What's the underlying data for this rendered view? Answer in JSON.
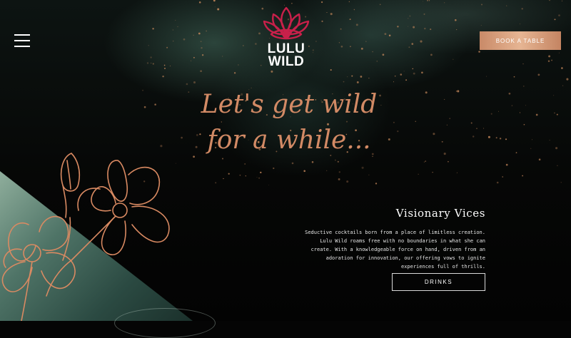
{
  "header": {
    "menu_icon": "hamburger-menu-icon",
    "logo": {
      "line1": "LULU",
      "line2": "WILD",
      "emblem_icon": "lotus-eye-icon",
      "emblem_color": "#c8204a"
    },
    "book_label": "BOOK A TABLE"
  },
  "hero": {
    "tagline_line1": "Let's get wild",
    "tagline_line2": "for a while..."
  },
  "section": {
    "title": "Visionary Vices",
    "lines": [
      "Seductive cocktails born from a place of limitless creation.",
      "Lulu Wild roams free with no boundaries in what she can",
      "create. With a knowledgeable force on hand, driven from an",
      "adoration for innovation, our offering vows to ignite",
      "experiences full of thrills."
    ],
    "button_label": "DRINKS"
  },
  "colors": {
    "accent": "#d28a65",
    "button_gradient_mid": "#e6b593",
    "background": "#050505"
  }
}
